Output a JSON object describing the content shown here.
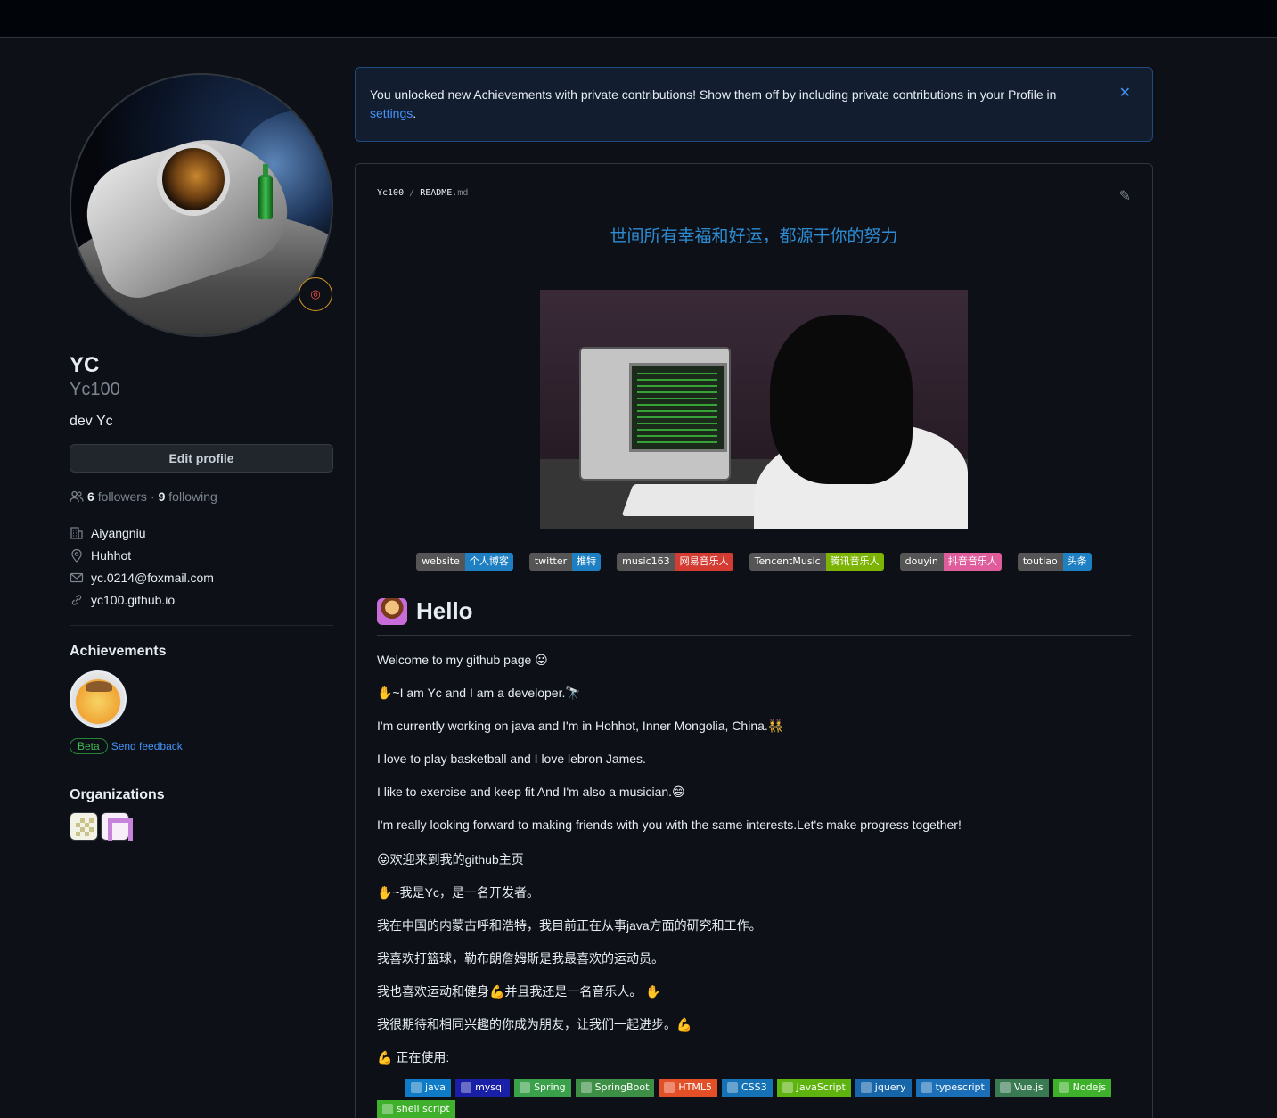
{
  "profile": {
    "fullname": "YC",
    "username": "Yc100",
    "bio": "dev Yc",
    "edit_button": "Edit profile",
    "followers_count": "6",
    "followers_label": "followers",
    "separator": "·",
    "following_count": "9",
    "following_label": "following",
    "details": {
      "company": "Aiyangniu",
      "location": "Huhhot",
      "email": "yc.0214@foxmail.com",
      "website": "yc100.github.io"
    },
    "achievements_title": "Achievements",
    "beta_label": "Beta",
    "feedback_link": "Send feedback",
    "organizations_title": "Organizations"
  },
  "flash": {
    "message": "You unlocked new Achievements with private contributions! Show them off by including private contributions in your Profile in",
    "link": "settings",
    "period": "."
  },
  "readme": {
    "repo": "Yc100",
    "sep": "/",
    "file": "README",
    "ext": ".md",
    "motto": "世间所有幸福和好运，都源于你的努力",
    "badges": [
      {
        "left": "website",
        "right": "个人博客",
        "color": "#1e7fc3"
      },
      {
        "left": "twitter",
        "right": "推特",
        "color": "#1e7fc3"
      },
      {
        "left": "music163",
        "right": "网易音乐人",
        "color": "#d43c33"
      },
      {
        "left": "TencentMusic",
        "right": "腾讯音乐人",
        "color": "#7cb305"
      },
      {
        "left": "douyin",
        "right": "抖音音乐人",
        "color": "#e05d9c"
      },
      {
        "left": "toutiao",
        "right": "头条",
        "color": "#1e7fc3"
      }
    ],
    "heading": "Hello",
    "paragraphs": [
      "Welcome to my github page 😛",
      "✋~I am Yc and I am a developer.🔭",
      "I'm currently working on java and I'm in Hohhot, Inner Mongolia, China.👯",
      "I love to play basketball and I love lebron James.",
      "I like to exercise and keep fit And I'm also a musician.😄",
      "I'm really looking forward to making friends with you with the same interests.Let's make progress together!",
      "😛欢迎来到我的github主页",
      "✋~我是Yc，是一名开发者。",
      "我在中国的内蒙古呼和浩特，我目前正在从事java方面的研究和工作。",
      "我喜欢打篮球，勒布朗詹姆斯是我最喜欢的运动员。",
      "我也喜欢运动和健身💪并且我还是一名音乐人。 ✋",
      "我很期待和相同兴趣的你成为朋友，让我们一起进步。💪",
      "💪 正在使用:"
    ],
    "tools": [
      {
        "label": "java",
        "color": "#0f7bc6"
      },
      {
        "label": "mysql",
        "color": "#1a1fa8"
      },
      {
        "label": "Spring",
        "color": "#3aa14a"
      },
      {
        "label": "SpringBoot",
        "color": "#3d8f45"
      },
      {
        "label": "HTML5",
        "color": "#e34f26"
      },
      {
        "label": "CSS3",
        "color": "#1572b6"
      },
      {
        "label": "JavaScript",
        "color": "#5fb30f"
      },
      {
        "label": "jquery",
        "color": "#1565a8"
      },
      {
        "label": "typescript",
        "color": "#1b6fb8"
      },
      {
        "label": "Vue.js",
        "color": "#3a7a53"
      },
      {
        "label": "Nodejs",
        "color": "#3fb02b"
      },
      {
        "label": "shell script",
        "color": "#3fb02b"
      }
    ]
  }
}
